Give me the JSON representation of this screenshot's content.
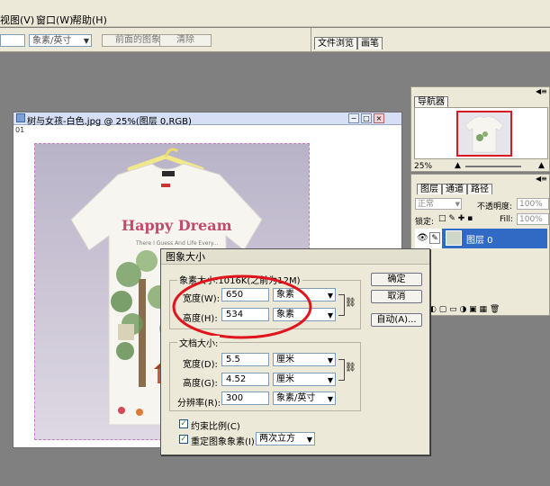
{
  "menu": {
    "items": [
      "视图(V)",
      "窗口(W)",
      "帮助(H)"
    ]
  },
  "options": {
    "unit_value": "象素/英寸",
    "front_image_label": "前面的图象",
    "clear_label": "清除"
  },
  "top_tabs": [
    "文件浏览",
    "画笔"
  ],
  "document": {
    "title": "树与女孩-白色.jpg @ 25%(图层 0,RGB)",
    "ruler_label": "01",
    "shirt_text": "Happy Dream"
  },
  "navigator": {
    "tab_label": "导航器",
    "zoom": "25%"
  },
  "layers": {
    "tabs": [
      "图层",
      "通道",
      "路径"
    ],
    "blend_mode": "正常",
    "opacity_label": "不透明度:",
    "opacity_value": "100%",
    "lock_label": "锁定:",
    "fill_label": "Fill:",
    "fill_value": "100%",
    "layer_name": "图层 0"
  },
  "dialog": {
    "title": "图象大小",
    "pixel_group_label": "象素大小:1016K(之前为12M)",
    "width_label": "宽度(W):",
    "width_value": "650",
    "width_unit": "象素",
    "height_label": "高度(H):",
    "height_value": "534",
    "height_unit": "象素",
    "doc_group_label": "文档大小:",
    "doc_width_label": "宽度(D):",
    "doc_width_value": "5.5",
    "doc_width_unit": "厘米",
    "doc_height_label": "高度(G):",
    "doc_height_value": "4.52",
    "doc_height_unit": "厘米",
    "resolution_label": "分辨率(R):",
    "resolution_value": "300",
    "resolution_unit": "象素/英寸",
    "constrain_label": "约束比例(C)",
    "resample_label": "重定图象象素(I):",
    "resample_method": "两次立方",
    "ok_label": "确定",
    "cancel_label": "取消",
    "auto_label": "自动(A)..."
  },
  "colors": {
    "annotation_red": "#e0141c",
    "selected_layer": "#316ac5"
  }
}
